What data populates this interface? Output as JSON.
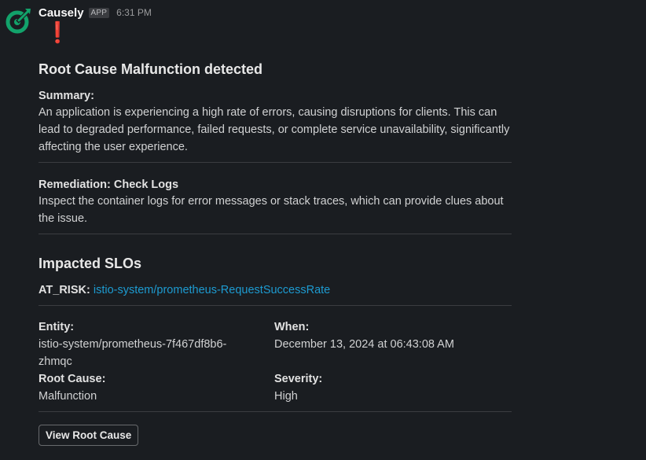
{
  "message": {
    "sender": "Causely",
    "app_badge": "APP",
    "time": "6:31 PM",
    "alert_icon": "exclamation-mark",
    "colors": {
      "alert": "#e01e1e",
      "link": "#1d9bd1",
      "brand": "#12a36b"
    }
  },
  "card": {
    "title": "Root Cause Malfunction detected",
    "summary_label": "Summary:",
    "summary_text": "An application is experiencing a high rate of errors, causing disruptions for clients. This can lead to degraded performance, failed requests, or complete service unavailability, significantly affecting the user experience.",
    "remediation_label": "Remediation: Check Logs",
    "remediation_text": "Inspect the container logs for error messages or stack traces, which can provide clues about the issue.",
    "slo_title": "Impacted SLOs",
    "slo_status": "AT_RISK",
    "slo_colon": ":",
    "slo_link": "istio-system/prometheus-RequestSuccessRate",
    "fields": {
      "entity_label": "Entity:",
      "entity_value": "istio-system/prometheus-7f467df8b6-zhmqc",
      "when_label": "When:",
      "when_value": "December 13, 2024 at 06:43:08 AM",
      "root_cause_label": "Root Cause:",
      "root_cause_value": "Malfunction",
      "severity_label": "Severity:",
      "severity_value": "High"
    },
    "button_label": "View Root Cause"
  }
}
